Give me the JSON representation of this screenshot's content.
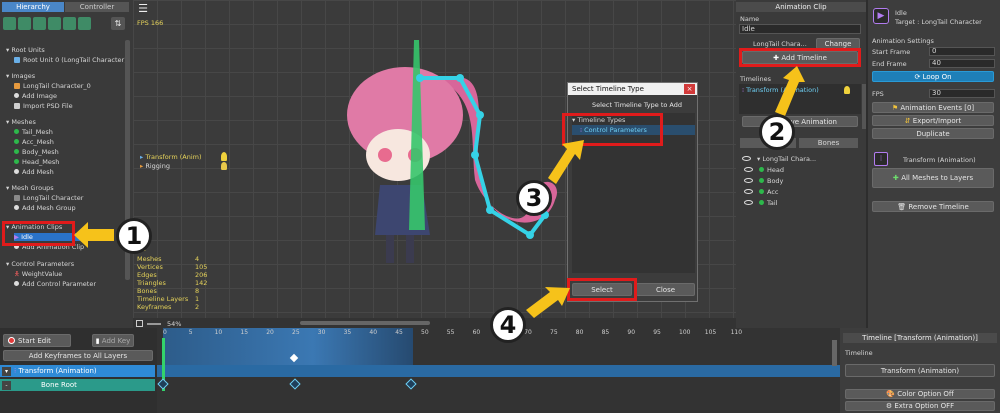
{
  "hierarchy": {
    "tabs": [
      "Hierarchy",
      "Controller"
    ],
    "sections": {
      "root_units": "Root Units",
      "root_unit_0": "Root Unit 0 (LongTail Character)",
      "images": "Images",
      "image_0": "LongTail Character_0",
      "add_image": "Add Image",
      "import_psd": "Import PSD File",
      "meshes": "Meshes",
      "tail_mesh": "Tail_Mesh",
      "acc_mesh": "Acc_Mesh",
      "body_mesh": "Body_Mesh",
      "head_mesh": "Head_Mesh",
      "add_mesh": "Add Mesh",
      "mesh_groups": "Mesh Groups",
      "mesh_group_0": "LongTail Character",
      "add_mesh_group": "Add Mesh Group",
      "animation_clips": "Animation Clips",
      "idle": "Idle",
      "add_animation_clip": "Add Animation Clip",
      "control_parameters": "Control Parameters",
      "weight_value": "WeightValue",
      "add_control_param": "Add Control Parameter"
    }
  },
  "viewport": {
    "fps": "FPS 166",
    "timeline_overlay": [
      "Transform (Anim)",
      "Rigging"
    ],
    "stats_partial": "ics",
    "stats": [
      {
        "k": "Meshes",
        "v": "4"
      },
      {
        "k": "Vertices",
        "v": "105"
      },
      {
        "k": "Edges",
        "v": "206"
      },
      {
        "k": "Triangles",
        "v": "142"
      },
      {
        "k": "Bones",
        "v": "8"
      },
      {
        "k": "Timeline Layers",
        "v": "1"
      },
      {
        "k": "Keyframes",
        "v": "2"
      }
    ],
    "zoom": "54%"
  },
  "dialog": {
    "title": "Select Timeline Type",
    "subtitle": "Select Timeline Type to Add",
    "group": "Timeline Types",
    "option": "Control Parameters",
    "select": "Select",
    "close": "Close"
  },
  "anim_clip_panel": {
    "header": "Animation Clip",
    "name_label": "Name",
    "name_value": "Idle",
    "target_partial": "LongTail Chara...",
    "change": "Change",
    "add_timeline": "Add Timeline",
    "timelines_label": "Timelines",
    "timeline_item": "Transform (Animation)",
    "remove_anim_partial": "Remove Animation",
    "tab_bones": "Bones",
    "tree_root": "LongTail Chara...",
    "tree_items": [
      "Head",
      "Body",
      "Acc",
      "Tail"
    ]
  },
  "right_panel": {
    "clip_name": "Idle",
    "target": "Target : LongTail Character",
    "settings_title": "Animation Settings",
    "start_frame_label": "Start Frame",
    "start_frame": "0",
    "end_frame_label": "End Frame",
    "end_frame": "40",
    "loop": "Loop On",
    "fps_label": "FPS",
    "fps": "30",
    "events": "Animation Events [0]",
    "export_import": "Export/Import",
    "duplicate": "Duplicate",
    "timeline_type": "Transform (Animation)",
    "all_meshes": "All Meshes to Layers",
    "remove_timeline": "Remove Timeline"
  },
  "timeline": {
    "start_edit": "Start Edit",
    "add_key": "Add Key",
    "add_keyframes_all": "Add Keyframes to All Layers",
    "ruler": [
      "0",
      "5",
      "10",
      "15",
      "20",
      "25",
      "30",
      "35",
      "40",
      "45",
      "50",
      "55",
      "60",
      "65",
      "70",
      "75",
      "80",
      "85",
      "90",
      "95",
      "100",
      "105",
      "110"
    ],
    "layer_row": "Transform (Animation)",
    "sub_row": "Bone Root"
  },
  "timeline_side": {
    "header": "Timeline [Transform (Animation)]",
    "label": "Timeline",
    "value": "Transform (Animation)",
    "color_opt": "Color Option Off",
    "extra_opt": "Extra Option OFF"
  },
  "callouts": [
    "1",
    "2",
    "3",
    "4"
  ],
  "colors": {
    "accent_blue": "#3e8fd6",
    "selection": "#2a73c9",
    "highlight_red": "#e01b1b",
    "arrow_yellow": "#f6c21a",
    "keyframe_range": "#3a6fa8"
  }
}
